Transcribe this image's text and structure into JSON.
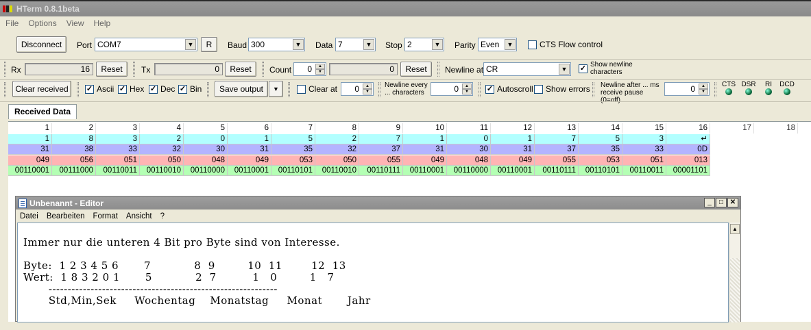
{
  "app": {
    "title": "HTerm 0.8.1beta"
  },
  "menu": [
    "File",
    "Options",
    "View",
    "Help"
  ],
  "toolbar1": {
    "disconnect": "Disconnect",
    "port_label": "Port",
    "port_value": "COM7",
    "r_button": "R",
    "baud_label": "Baud",
    "baud_value": "300",
    "data_label": "Data",
    "data_value": "7",
    "stop_label": "Stop",
    "stop_value": "2",
    "parity_label": "Parity",
    "parity_value": "Even",
    "cts_label": "CTS Flow control"
  },
  "toolbar2": {
    "rx_label": "Rx",
    "rx_value": "16",
    "reset": "Reset",
    "tx_label": "Tx",
    "tx_value": "0",
    "count_label": "Count",
    "count_value": "0",
    "count_field": "0",
    "newline_at_label": "Newline at",
    "newline_at_value": "CR",
    "show_newline_label": "Show newline characters"
  },
  "toolbar3": {
    "clear_received": "Clear received",
    "ascii": "Ascii",
    "hex": "Hex",
    "dec": "Dec",
    "bin": "Bin",
    "save_output": "Save output",
    "clear_at": "Clear at",
    "clear_at_value": "0",
    "newline_every": "Newline every ... characters",
    "newline_every_value": "0",
    "autoscroll": "Autoscroll",
    "show_errors": "Show errors",
    "newline_after": "Newline after ... ms receive pause (0=off)",
    "newline_after_value": "0",
    "leds": [
      "CTS",
      "DSR",
      "RI",
      "DCD"
    ]
  },
  "tab": {
    "received_data": "Received Data"
  },
  "received": {
    "headers": [
      "1",
      "2",
      "3",
      "4",
      "5",
      "6",
      "7",
      "8",
      "9",
      "10",
      "11",
      "12",
      "13",
      "14",
      "15",
      "16",
      "17",
      "18"
    ],
    "ascii": [
      "1",
      "8",
      "3",
      "2",
      "0",
      "1",
      "5",
      "2",
      "7",
      "1",
      "0",
      "1",
      "7",
      "5",
      "3",
      "↵"
    ],
    "hex": [
      "31",
      "38",
      "33",
      "32",
      "30",
      "31",
      "35",
      "32",
      "37",
      "31",
      "30",
      "31",
      "37",
      "35",
      "33",
      "0D"
    ],
    "dec": [
      "049",
      "056",
      "051",
      "050",
      "048",
      "049",
      "053",
      "050",
      "055",
      "049",
      "048",
      "049",
      "055",
      "053",
      "051",
      "013"
    ],
    "bin": [
      "00110001",
      "00111000",
      "00110011",
      "00110010",
      "00110000",
      "00110001",
      "00110101",
      "00110010",
      "00110111",
      "00110001",
      "00110000",
      "00110001",
      "00110111",
      "00110101",
      "00110011",
      "00001101"
    ],
    "colors": {
      "ascii": "#b2ffff",
      "hex": "#b4b4ff",
      "dec": "#ffb4b4",
      "bin": "#b4ffb4"
    }
  },
  "editor": {
    "title": "Unbenannt - Editor",
    "menu": [
      "Datei",
      "Bearbeiten",
      "Format",
      "Ansicht",
      "?"
    ],
    "lines": [
      "Immer nur die unteren 4 Bit pro Byte sind von Interesse.",
      "",
      "Byte:  1 2 3 4 5 6       7            8  9         10  11        12  13",
      "Wert:  1 8 3 2 0 1       5            2  7          1   0         1   7",
      "       ------------------------------------------------------------",
      "       Std,Min,Sek     Wochentag    Monatstag     Monat       Jahr"
    ]
  }
}
